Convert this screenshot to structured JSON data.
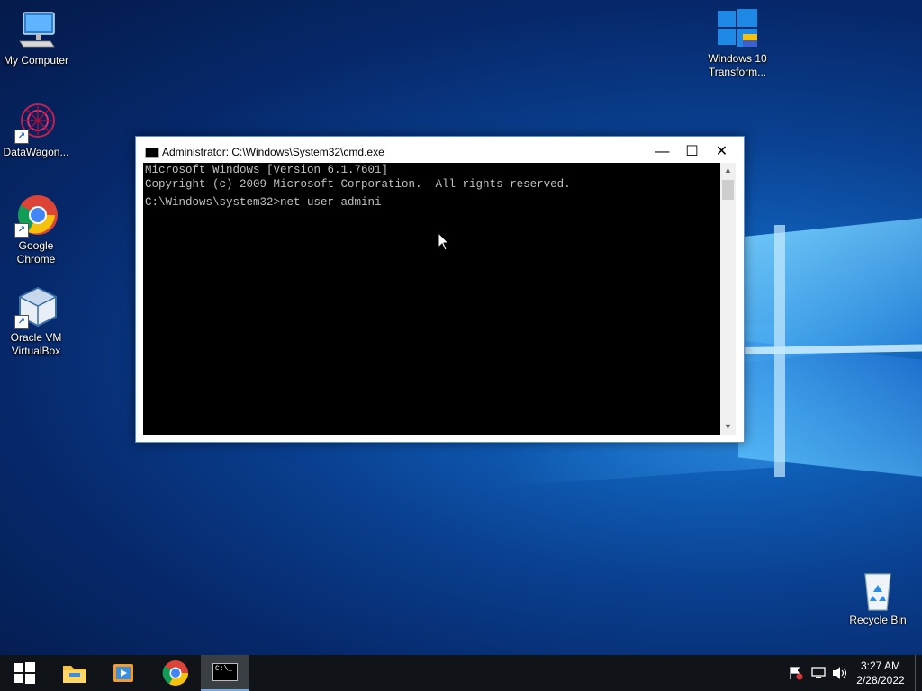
{
  "desktop": {
    "icons": [
      {
        "label": "My Computer"
      },
      {
        "label": "DataWagon..."
      },
      {
        "label": "Google Chrome"
      },
      {
        "label": "Oracle VM VirtualBox"
      },
      {
        "label": "Windows 10 Transform..."
      },
      {
        "label": "Recycle Bin"
      }
    ]
  },
  "cmd": {
    "title": "Administrator: C:\\Windows\\System32\\cmd.exe",
    "lines": [
      "Microsoft Windows [Version 6.1.7601]",
      "Copyright (c) 2009 Microsoft Corporation.  All rights reserved.",
      "",
      "C:\\Windows\\system32>net user admini"
    ],
    "minimize_glyph": "—",
    "maximize_glyph": "☐",
    "close_glyph": "✕"
  },
  "taskbar": {
    "clock_time": "3:27 AM",
    "clock_date": "2/28/2022",
    "cmd_icon_text": "C:\\_"
  },
  "icons": {
    "start": "windows-logo-icon",
    "explorer": "folder-icon",
    "media": "media-player-icon",
    "chrome": "chrome-icon",
    "cmd": "cmd-icon",
    "flag": "action-center-flag-icon",
    "network": "network-icon",
    "volume": "volume-icon"
  },
  "colors": {
    "console_bg": "#000000",
    "console_text": "#c0c0c0",
    "taskbar_bg": "#101418",
    "accent": "#0078d7"
  }
}
